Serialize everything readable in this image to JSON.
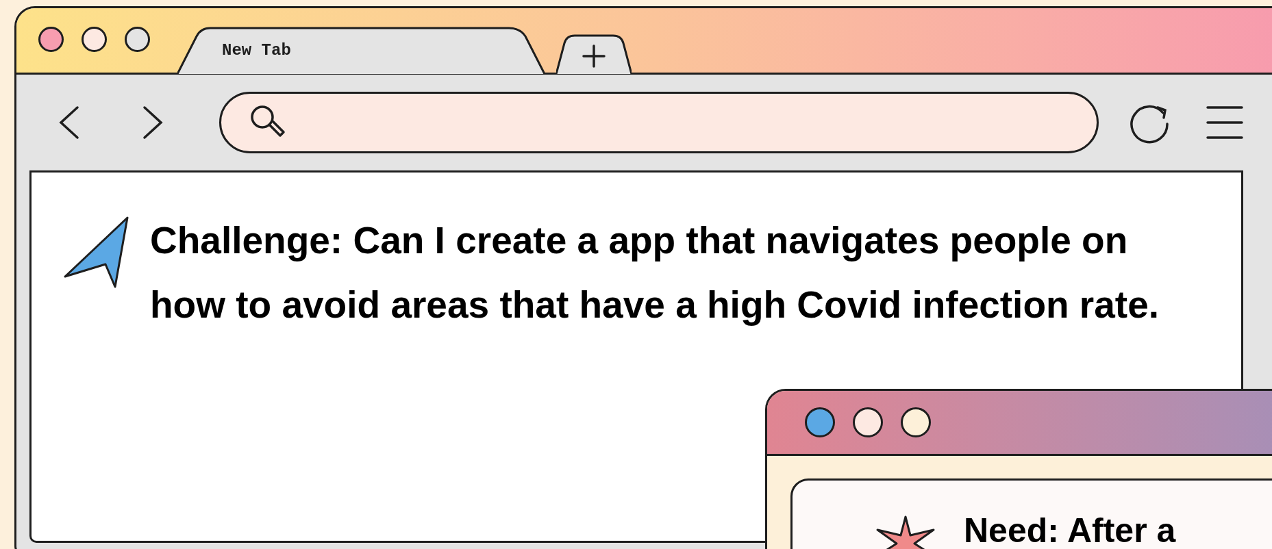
{
  "browser": {
    "window_buttons": [
      {
        "color": "#f79db0"
      },
      {
        "color": "#fde9e2"
      },
      {
        "color": "#e4e4e4"
      }
    ],
    "tabs": [
      {
        "label": "New Tab",
        "selected": true
      }
    ],
    "content": {
      "text": "Challenge: Can I create a app that navigates people on how to avoid areas that have a high Covid infection rate."
    }
  },
  "popup_window": {
    "window_buttons": [
      {
        "color": "#5ba8e4"
      },
      {
        "color": "#fde9e2"
      },
      {
        "color": "#fdf0d9"
      }
    ],
    "heading": "Need: After a"
  }
}
